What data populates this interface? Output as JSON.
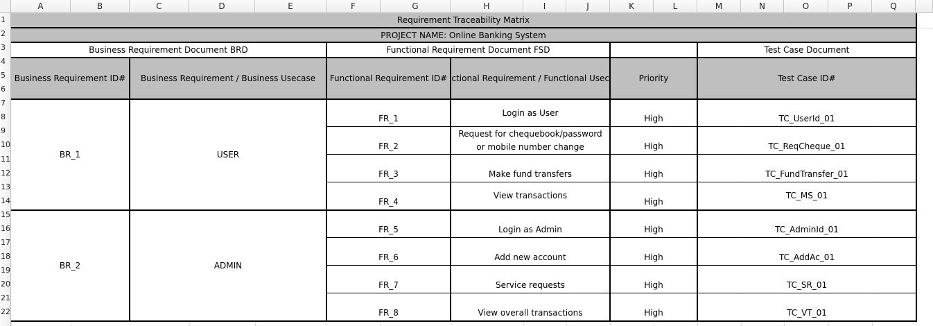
{
  "column_headers": [
    "A",
    "B",
    "C",
    "D",
    "E",
    "F",
    "G",
    "H",
    "I",
    "J",
    "K",
    "L",
    "M",
    "N",
    "O",
    "P",
    "Q"
  ],
  "row_numbers": [
    "1",
    "2",
    "3",
    "4",
    "5",
    "6",
    "7",
    "8",
    "9",
    "10",
    "11",
    "12",
    "13",
    "14",
    "15",
    "16",
    "17",
    "18",
    "19",
    "20",
    "21",
    "22"
  ],
  "matrix": {
    "title": "Requirement Traceability Matrix",
    "project": "PROJECT NAME: Online Banking System",
    "groups": {
      "brd": "Business Requirement Document BRD",
      "fsd": "Functional Requirement Document FSD",
      "priority": "",
      "tcd": "Test Case Document"
    },
    "headers": {
      "br_id": "Business Requirement ID#",
      "br_usecase": "Business Requirement / Business Usecase",
      "fr_id": "Functional Requirement ID#",
      "fr_usecase": "Functional  Requirement / Functional Usecase",
      "priority": "Priority",
      "tc_id": "Test Case ID#"
    },
    "business_requirements": [
      {
        "id": "BR_1",
        "usecase": "USER"
      },
      {
        "id": "BR_2",
        "usecase": "ADMIN"
      }
    ],
    "rows": [
      {
        "fr_id": "FR_1",
        "fr_usecase": "Login as User",
        "priority": "High",
        "tc_id": "TC_UserId_01"
      },
      {
        "fr_id": "FR_2",
        "fr_usecase": "Request for chequebook/password or mobile number change",
        "priority": "High",
        "tc_id": "TC_ReqCheque_01"
      },
      {
        "fr_id": "FR_3",
        "fr_usecase": "Make fund transfers",
        "priority": "High",
        "tc_id": "TC_FundTransfer_01"
      },
      {
        "fr_id": "FR_4",
        "fr_usecase": "View  transactions",
        "priority": "High",
        "tc_id": "TC_MS_01"
      },
      {
        "fr_id": "FR_5",
        "fr_usecase": "Login as Admin",
        "priority": "High",
        "tc_id": "TC_AdminId_01"
      },
      {
        "fr_id": "FR_6",
        "fr_usecase": "Add new account",
        "priority": "High",
        "tc_id": "TC_AddAc_01"
      },
      {
        "fr_id": "FR_7",
        "fr_usecase": "Service requests",
        "priority": "High",
        "tc_id": "TC_SR_01"
      },
      {
        "fr_id": "FR_8",
        "fr_usecase": "View overall transactions",
        "priority": "High",
        "tc_id": "TC_VT_01"
      }
    ]
  },
  "colors": {
    "header_fill": "#bfbfbf",
    "border": "#000000",
    "gridline": "#d9d9d9",
    "headers_bg": "#f0f0f0"
  }
}
